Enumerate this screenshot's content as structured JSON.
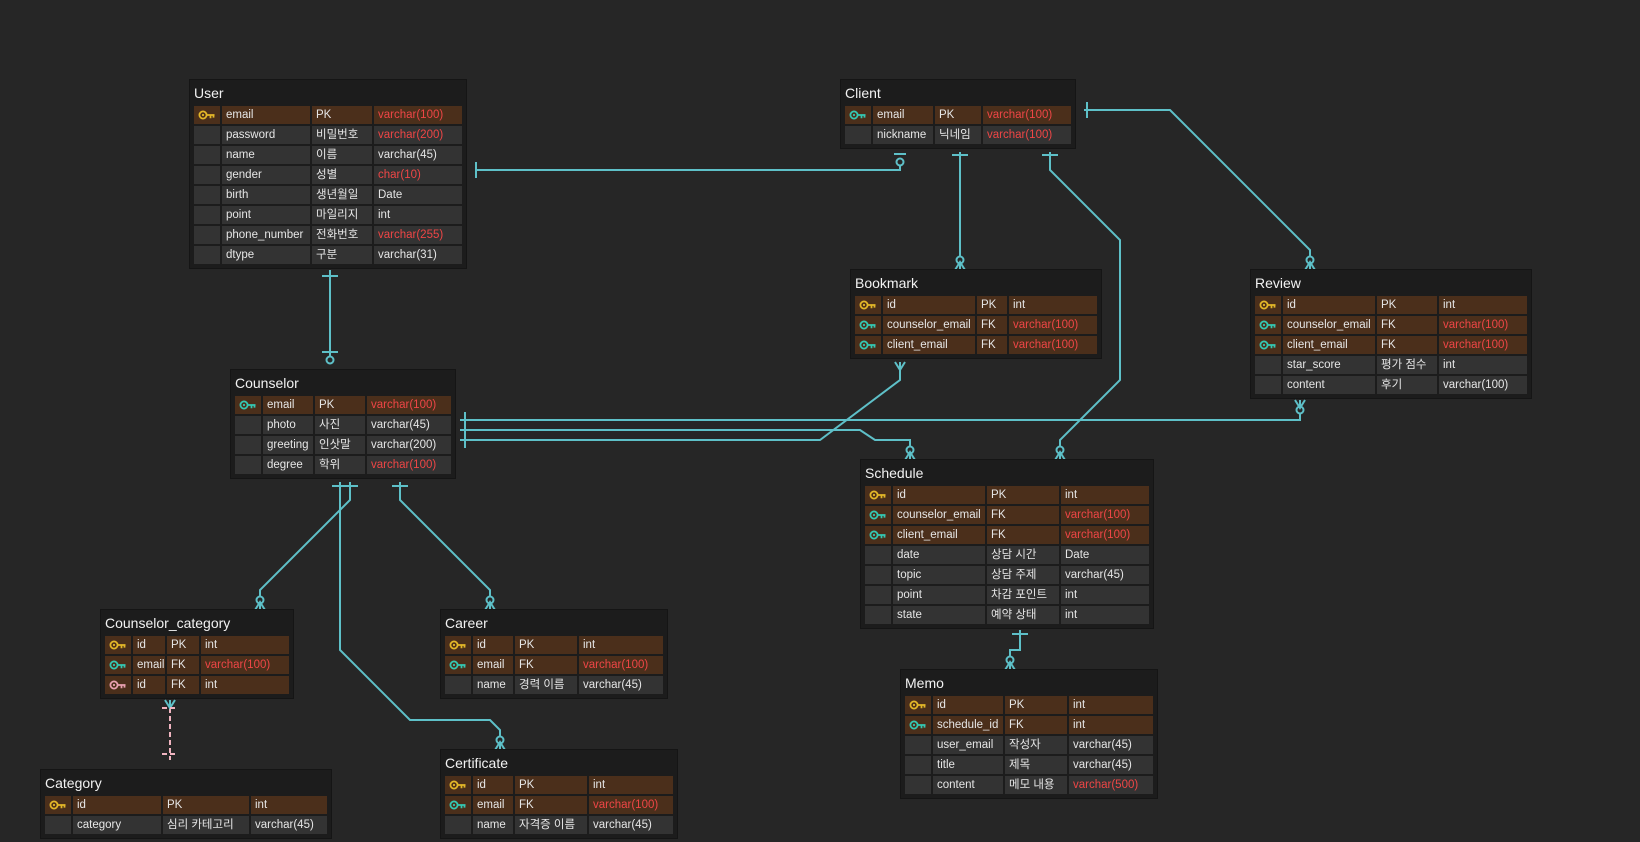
{
  "diagram": {
    "entities": [
      {
        "id": "user",
        "title": "User",
        "rows": [
          {
            "key": "primary",
            "name": "email",
            "label": "PK",
            "type": "varchar(100)",
            "highlight": true
          },
          {
            "key": "none",
            "name": "password",
            "label": "비밀번호",
            "type": "varchar(200)",
            "highlight": true
          },
          {
            "key": "none",
            "name": "name",
            "label": "이름",
            "type": "varchar(45)",
            "highlight": false
          },
          {
            "key": "none",
            "name": "gender",
            "label": "성별",
            "type": "char(10)",
            "highlight": true
          },
          {
            "key": "none",
            "name": "birth",
            "label": "생년월일",
            "type": "Date",
            "highlight": false
          },
          {
            "key": "none",
            "name": "point",
            "label": "마일리지",
            "type": "int",
            "highlight": false
          },
          {
            "key": "none",
            "name": "phone_number",
            "label": "전화번호",
            "type": "varchar(255)",
            "highlight": true
          },
          {
            "key": "none",
            "name": "dtype",
            "label": "구분",
            "type": "varchar(31)",
            "highlight": false
          }
        ]
      },
      {
        "id": "client",
        "title": "Client",
        "rows": [
          {
            "key": "primary-foreign",
            "name": "email",
            "label": "PK",
            "type": "varchar(100)",
            "highlight": true
          },
          {
            "key": "none",
            "name": "nickname",
            "label": "닉네임",
            "type": "varchar(100)",
            "highlight": true
          }
        ]
      },
      {
        "id": "bookmark",
        "title": "Bookmark",
        "rows": [
          {
            "key": "primary",
            "name": "id",
            "label": "PK",
            "type": "int",
            "highlight": false
          },
          {
            "key": "foreign",
            "name": "counselor_email",
            "label": "FK",
            "type": "varchar(100)",
            "highlight": true
          },
          {
            "key": "foreign",
            "name": "client_email",
            "label": "FK",
            "type": "varchar(100)",
            "highlight": true
          }
        ]
      },
      {
        "id": "review",
        "title": "Review",
        "rows": [
          {
            "key": "primary",
            "name": "id",
            "label": "PK",
            "type": "int",
            "highlight": false
          },
          {
            "key": "foreign",
            "name": "counselor_email",
            "label": "FK",
            "type": "varchar(100)",
            "highlight": true
          },
          {
            "key": "foreign",
            "name": "client_email",
            "label": "FK",
            "type": "varchar(100)",
            "highlight": true
          },
          {
            "key": "none",
            "name": "star_score",
            "label": "평가 점수",
            "type": "int",
            "highlight": false
          },
          {
            "key": "none",
            "name": "content",
            "label": "후기",
            "type": "varchar(100)",
            "highlight": false
          }
        ]
      },
      {
        "id": "counselor",
        "title": "Counselor",
        "rows": [
          {
            "key": "primary-foreign",
            "name": "email",
            "label": "PK",
            "type": "varchar(100)",
            "highlight": true
          },
          {
            "key": "none",
            "name": "photo",
            "label": "사진",
            "type": "varchar(45)",
            "highlight": false
          },
          {
            "key": "none",
            "name": "greeting",
            "label": "인삿말",
            "type": "varchar(200)",
            "highlight": false
          },
          {
            "key": "none",
            "name": "degree",
            "label": "학위",
            "type": "varchar(100)",
            "highlight": true
          }
        ]
      },
      {
        "id": "schedule",
        "title": "Schedule",
        "rows": [
          {
            "key": "primary",
            "name": "id",
            "label": "PK",
            "type": "int",
            "highlight": false
          },
          {
            "key": "foreign",
            "name": "counselor_email",
            "label": "FK",
            "type": "varchar(100)",
            "highlight": true
          },
          {
            "key": "foreign",
            "name": "client_email",
            "label": "FK",
            "type": "varchar(100)",
            "highlight": true
          },
          {
            "key": "none",
            "name": "date",
            "label": "상담 시간",
            "type": "Date",
            "highlight": false
          },
          {
            "key": "none",
            "name": "topic",
            "label": "상담 주제",
            "type": "varchar(45)",
            "highlight": false
          },
          {
            "key": "none",
            "name": "point",
            "label": "차감 포인트",
            "type": "int",
            "highlight": false
          },
          {
            "key": "none",
            "name": "state",
            "label": "예약 상태",
            "type": "int",
            "highlight": false
          }
        ]
      },
      {
        "id": "counselor_category",
        "title": "Counselor_category",
        "rows": [
          {
            "key": "primary",
            "name": "id",
            "label": "PK",
            "type": "int",
            "highlight": false
          },
          {
            "key": "foreign",
            "name": "email",
            "label": "FK",
            "type": "varchar(100)",
            "highlight": true
          },
          {
            "key": "foreign-pink",
            "name": "id",
            "label": "FK",
            "type": "int",
            "highlight": false
          }
        ]
      },
      {
        "id": "career",
        "title": "Career",
        "rows": [
          {
            "key": "primary",
            "name": "id",
            "label": "PK",
            "type": "int",
            "highlight": false
          },
          {
            "key": "foreign",
            "name": "email",
            "label": "FK",
            "type": "varchar(100)",
            "highlight": true
          },
          {
            "key": "none",
            "name": "name",
            "label": "경력 이름",
            "type": "varchar(45)",
            "highlight": false
          }
        ]
      },
      {
        "id": "memo",
        "title": "Memo",
        "rows": [
          {
            "key": "primary",
            "name": "id",
            "label": "PK",
            "type": "int",
            "highlight": false
          },
          {
            "key": "foreign",
            "name": "schedule_id",
            "label": "FK",
            "type": "int",
            "highlight": false
          },
          {
            "key": "none",
            "name": "user_email",
            "label": "작성자",
            "type": "varchar(45)",
            "highlight": false
          },
          {
            "key": "none",
            "name": "title",
            "label": "제목",
            "type": "varchar(45)",
            "highlight": false
          },
          {
            "key": "none",
            "name": "content",
            "label": "메모 내용",
            "type": "varchar(500)",
            "highlight": true
          }
        ]
      },
      {
        "id": "category",
        "title": "Category",
        "rows": [
          {
            "key": "primary",
            "name": "id",
            "label": "PK",
            "type": "int",
            "highlight": false
          },
          {
            "key": "none",
            "name": "category",
            "label": "심리 카테고리",
            "type": "varchar(45)",
            "highlight": false
          }
        ]
      },
      {
        "id": "certificate",
        "title": "Certificate",
        "rows": [
          {
            "key": "primary",
            "name": "id",
            "label": "PK",
            "type": "int",
            "highlight": false
          },
          {
            "key": "foreign",
            "name": "email",
            "label": "FK",
            "type": "varchar(100)",
            "highlight": true
          },
          {
            "key": "none",
            "name": "name",
            "label": "자격증 이름",
            "type": "varchar(45)",
            "highlight": false
          }
        ]
      }
    ],
    "relationships": [
      {
        "from": "user",
        "to": "client",
        "from_end": "one",
        "to_end": "zero-or-one"
      },
      {
        "from": "user",
        "to": "counselor",
        "from_end": "one",
        "to_end": "zero-or-one"
      },
      {
        "from": "client",
        "to": "bookmark",
        "from_end": "one",
        "to_end": "zero-or-many"
      },
      {
        "from": "client",
        "to": "schedule",
        "from_end": "one",
        "to_end": "zero-or-many"
      },
      {
        "from": "client",
        "to": "review",
        "from_end": "one",
        "to_end": "zero-or-many"
      },
      {
        "from": "counselor",
        "to": "bookmark",
        "from_end": "one",
        "to_end": "zero-or-many"
      },
      {
        "from": "counselor",
        "to": "review",
        "from_end": "one",
        "to_end": "zero-or-many"
      },
      {
        "from": "counselor",
        "to": "schedule",
        "from_end": "one",
        "to_end": "zero-or-many"
      },
      {
        "from": "counselor",
        "to": "counselor_category",
        "from_end": "one",
        "to_end": "zero-or-many"
      },
      {
        "from": "counselor",
        "to": "career",
        "from_end": "one",
        "to_end": "zero-or-many"
      },
      {
        "from": "counselor",
        "to": "certificate",
        "from_end": "one",
        "to_end": "zero-or-many"
      },
      {
        "from": "schedule",
        "to": "memo",
        "from_end": "one",
        "to_end": "zero-or-many"
      },
      {
        "from": "category",
        "to": "counselor_category",
        "from_end": "one",
        "to_end": "one-or-many",
        "style": "dashed"
      }
    ],
    "colors": {
      "background": "#262626",
      "connector": "#5ec0c8",
      "dashed_connector": "#f0b4c0",
      "key_row": "#4b2f1b",
      "primary_key": "#e3b628",
      "foreign_key": "#34c8b4",
      "pink_key": "#e8a0b0",
      "red_type": "#ee4646"
    }
  }
}
